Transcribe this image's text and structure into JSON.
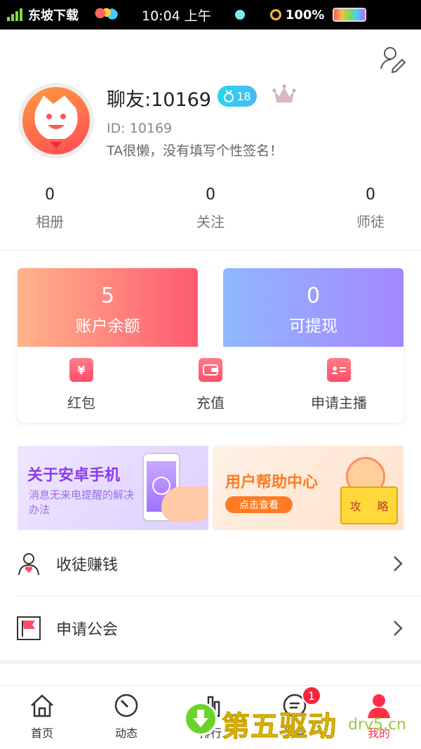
{
  "status_bar": {
    "carrier": "东坡下载",
    "time": "10:04 上午",
    "battery": "100%"
  },
  "profile": {
    "nickname": "聊友:10169",
    "level": "18",
    "user_id": "ID: 10169",
    "signature": "TA很懒，没有填写个性签名！"
  },
  "stats": [
    {
      "value": "0",
      "label": "相册"
    },
    {
      "value": "0",
      "label": "关注"
    },
    {
      "value": "0",
      "label": "师徒"
    }
  ],
  "wallet": {
    "balance_value": "5",
    "balance_label": "账户余额",
    "withdraw_value": "0",
    "withdraw_label": "可提现",
    "actions": [
      {
        "label": "红包",
        "icon": "red-envelope-icon"
      },
      {
        "label": "充值",
        "icon": "wallet-icon"
      },
      {
        "label": "申请主播",
        "icon": "id-card-icon"
      }
    ]
  },
  "banners": {
    "left_title": "关于安卓手机",
    "left_subtitle": "消息无来电提醒的解决办法",
    "right_title": "用户帮助中心",
    "right_button": "点击查看",
    "book_left": "攻",
    "book_right": "略"
  },
  "menu": [
    {
      "label": "收徒赚钱",
      "icon": "apprentice-icon"
    },
    {
      "label": "申请公会",
      "icon": "flag-icon"
    }
  ],
  "tabs": [
    {
      "label": "首页",
      "icon": "home-icon"
    },
    {
      "label": "动态",
      "icon": "dial-icon"
    },
    {
      "label": "排行",
      "icon": "ranking-icon"
    },
    {
      "label": "消息",
      "icon": "message-icon",
      "badge": "1"
    },
    {
      "label": "我的",
      "icon": "person-icon",
      "active": true
    }
  ],
  "watermark": {
    "text": "第五驱动",
    "domain": "drv5.cn"
  },
  "colors": {
    "accent": "#ff3048",
    "level_badge": "#27d3f0",
    "balance_gradient": [
      "#ffb48a",
      "#ff5a72"
    ],
    "withdraw_gradient": [
      "#8fb8ff",
      "#a587ff"
    ]
  }
}
